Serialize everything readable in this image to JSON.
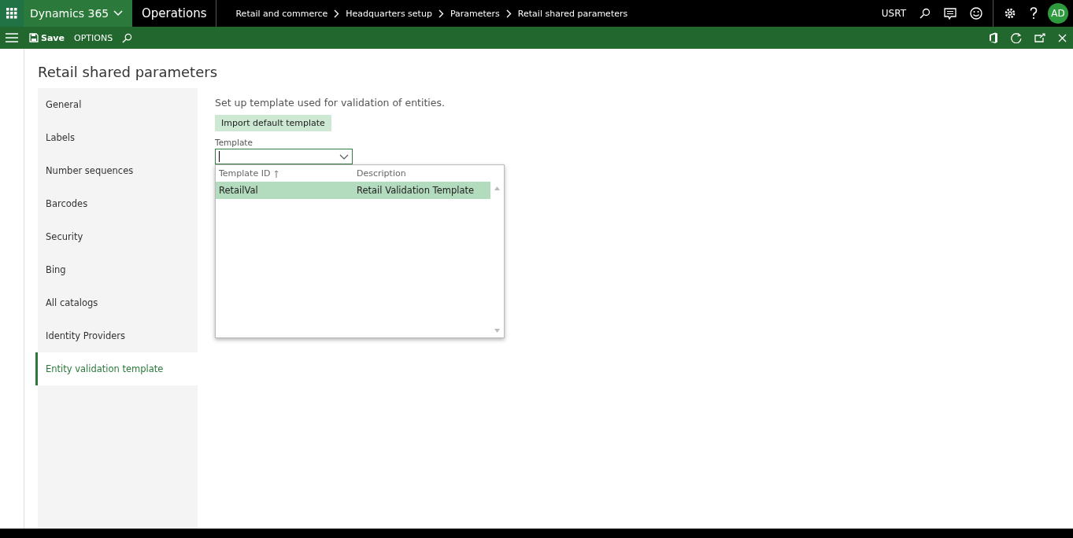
{
  "app_bar": {
    "app_name": "Dynamics 365",
    "module": "Operations",
    "breadcrumbs": [
      "Retail and commerce",
      "Headquarters setup",
      "Parameters",
      "Retail shared parameters"
    ],
    "company": "USRT",
    "avatar": "AD"
  },
  "action_bar": {
    "save": "Save",
    "options": "OPTIONS"
  },
  "page": {
    "title": "Retail shared parameters"
  },
  "nav": [
    {
      "label": "General",
      "selected": false
    },
    {
      "label": "Labels",
      "selected": false
    },
    {
      "label": "Number sequences",
      "selected": false
    },
    {
      "label": "Barcodes",
      "selected": false
    },
    {
      "label": "Security",
      "selected": false
    },
    {
      "label": "Bing",
      "selected": false
    },
    {
      "label": "All catalogs",
      "selected": false
    },
    {
      "label": "Identity Providers",
      "selected": false
    },
    {
      "label": "Entity validation template",
      "selected": true
    }
  ],
  "content": {
    "description": "Set up template used for validation of entities.",
    "button": "Import default template",
    "field_label": "Template",
    "lookup": {
      "columns": [
        "Template ID",
        "Description"
      ],
      "rows": [
        {
          "cells": [
            "RetailVal",
            "Retail Validation Template"
          ],
          "selected": true
        }
      ]
    }
  }
}
